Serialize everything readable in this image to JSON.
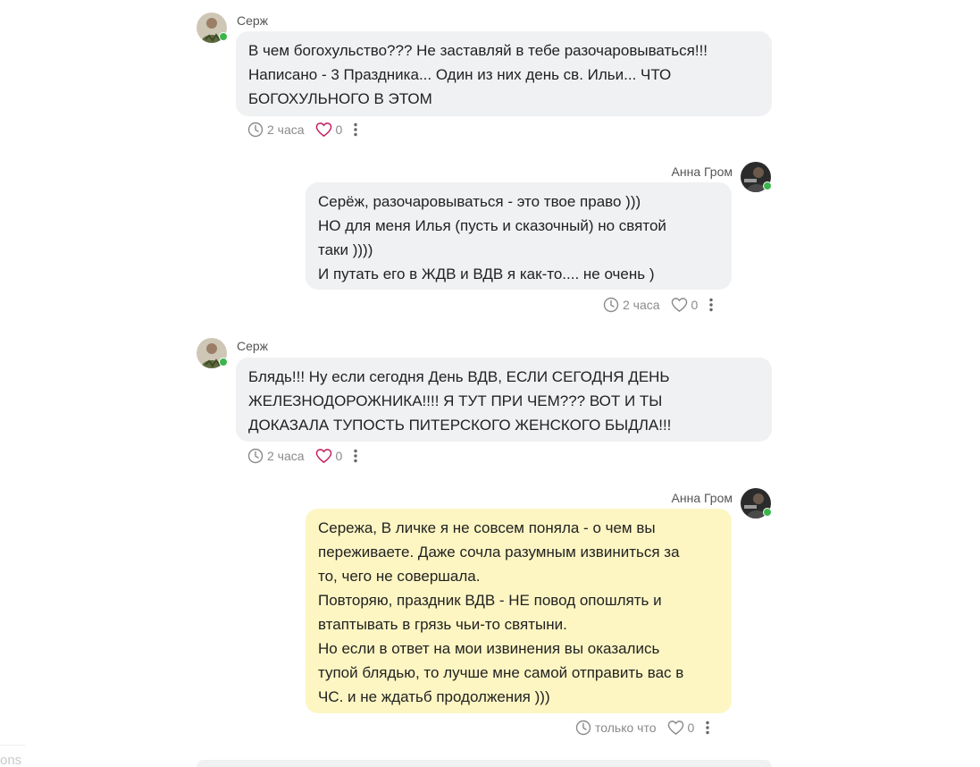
{
  "messages": [
    {
      "author": "Серж",
      "side": "left",
      "bubble_color": "#f0f1f3",
      "lines": [
        "В чем богохульство??? Не заставляй в тебе разочаровываться!!!",
        "Написано - 3 Праздника... Один из них день св. Ильи... ЧТО",
        "БОГОХУЛЬНОГО В ЭТОМ"
      ],
      "time": "2 часа",
      "likes": "0",
      "heart_color": "#c2185b"
    },
    {
      "author": "Анна Гром",
      "side": "right",
      "bubble_color": "#f0f1f3",
      "lines": [
        "Серёж, разочаровываться - это твое право )))",
        "НО для меня Илья (пусть и сказочный) но святой",
        "таки ))))",
        "И путать его в ЖДВ и ВДВ я как-то.... не очень )"
      ],
      "time": "2 часа",
      "likes": "0",
      "heart_color": "#8a8a8a"
    },
    {
      "author": "Серж",
      "side": "left",
      "bubble_color": "#f0f1f3",
      "lines": [
        "Блядь!!! Ну если сегодня День ВДВ, ЕСЛИ СЕГОДНЯ ДЕНЬ",
        "ЖЕЛЕЗНОДОРОЖНИКА!!!! Я ТУТ ПРИ ЧЕМ??? ВОТ И ТЫ",
        "ДОКАЗАЛА ТУПОСТЬ ПИТЕРСКОГО ЖЕНСКОГО БЫДЛА!!!"
      ],
      "time": "2 часа",
      "likes": "0",
      "heart_color": "#c2185b"
    },
    {
      "author": "Анна Гром",
      "side": "right",
      "bubble_color": "#fdf6c3",
      "lines": [
        "Сережа, В личке я не совсем поняла - о чем вы",
        "переживаете. Даже сочла разумным извиниться за",
        "то, чего не совершала.",
        "Повторяю, праздник ВДВ - НЕ повод опошлять и",
        "втаптывать в грязь чьи-то святыни.",
        "Но если в ответ на мои извинения вы оказались",
        "тупой блядью, то лучше мне самой отправить вас в",
        "ЧС. и не ждатьб продолжения )))"
      ],
      "time": "только что",
      "likes": "0",
      "heart_color": "#8a8a8a"
    }
  ],
  "corner_text": "ons",
  "icons": {
    "time": "clock-icon",
    "like": "heart-icon",
    "menu": "more-vertical-icon",
    "presence": "online-dot-icon"
  },
  "colors": {
    "online": "#3bb54a",
    "meta_text": "#8a8a8a",
    "bubble_gray": "#f0f1f3",
    "bubble_own_new": "#fdf6c3"
  }
}
